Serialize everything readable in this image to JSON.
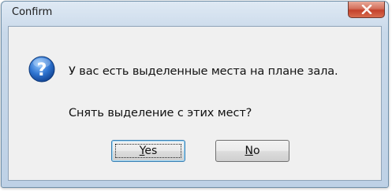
{
  "window": {
    "title": "Confirm",
    "close_label": "Close"
  },
  "dialog": {
    "icon": "question-icon",
    "message_line1": "У вас есть выделенные места на плане зала.",
    "message_line2": "Снять выделение с этих мест?"
  },
  "buttons": {
    "yes": {
      "mnemonic": "Y",
      "rest": "es",
      "default": true
    },
    "no": {
      "mnemonic": "N",
      "rest": "o",
      "default": false
    }
  },
  "colors": {
    "close_button": "#c4412b",
    "icon_blue": "#2b6cc4",
    "focus_border": "#3c7fb1"
  }
}
